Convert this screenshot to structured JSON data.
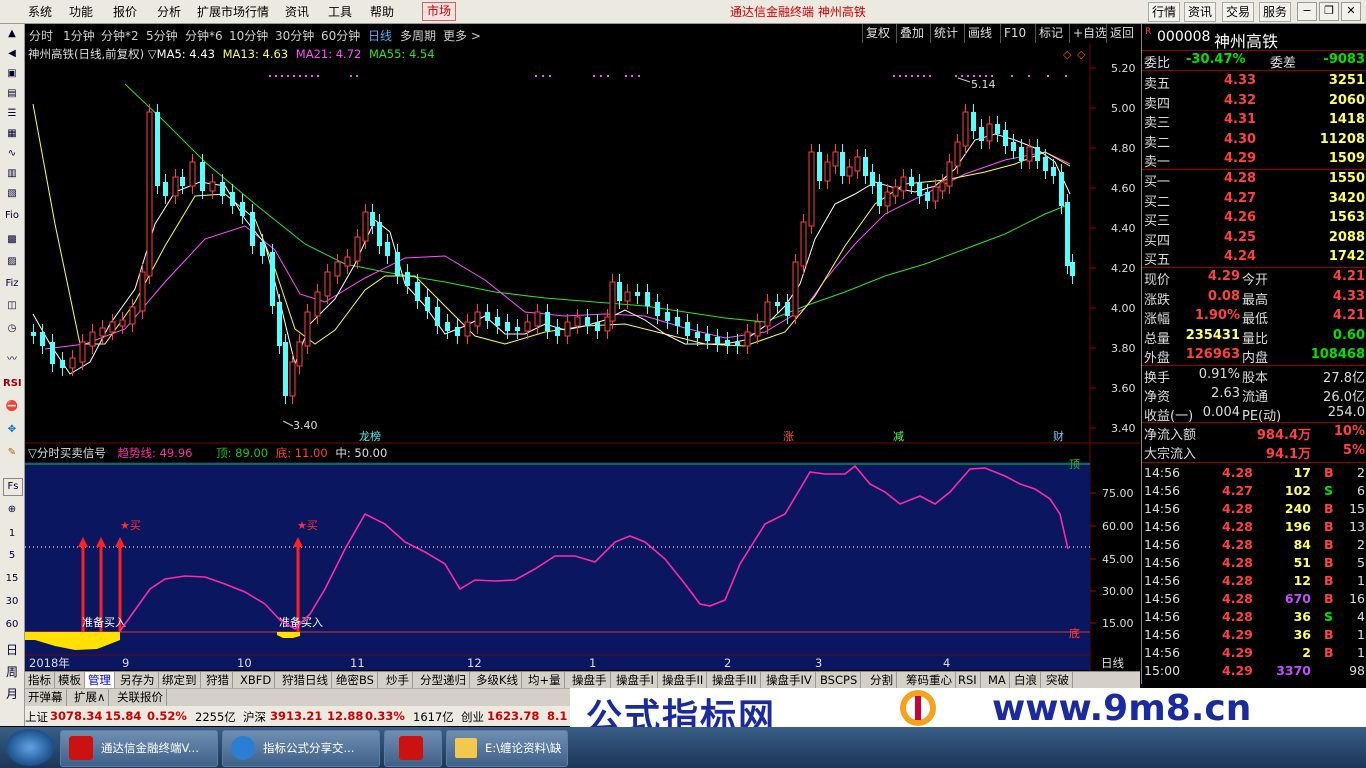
{
  "app": {
    "window_title": "通达信金融终端 神州高铁"
  },
  "menu": {
    "items": [
      "系统",
      "功能",
      "报价",
      "分析",
      "扩展市场行情",
      "资讯",
      "工具",
      "帮助"
    ],
    "market_label": "市场",
    "right_buttons": [
      "行情",
      "资讯",
      "交易",
      "服务"
    ]
  },
  "left_toolbar": {
    "period_labels": [
      "1",
      "5",
      "15",
      "30",
      "60",
      "日",
      "周",
      "月"
    ],
    "text_items": [
      "RSI",
      "Fs"
    ]
  },
  "chart_toolbar": {
    "periods": [
      "分时",
      "1分钟",
      "分钟*2",
      "5分钟",
      "分钟*6",
      "10分钟",
      "30分钟",
      "60分钟",
      "日线",
      "多周期",
      "更多 >"
    ],
    "active_period": "日线",
    "right_buttons": [
      "复权",
      "叠加",
      "统计",
      "画线",
      "F10",
      "标记",
      "+自选",
      "返回"
    ]
  },
  "kline_info": {
    "title": "神州高铁(日线,前复权)",
    "ma5": "MA5: 4.43",
    "ma13": "MA13: 4.63",
    "ma21": "MA21: 4.72",
    "ma55": "MA55: 4.54",
    "high_label": "5.14",
    "low_label": "3.40",
    "y_ticks": [
      "5.20",
      "5.00",
      "4.80",
      "4.60",
      "4.40",
      "4.20",
      "4.00",
      "3.80",
      "3.60",
      "3.40"
    ],
    "event_markers": [
      "龙榜",
      "涨",
      "减",
      "财"
    ]
  },
  "indicator": {
    "name": "分时买卖信号",
    "trend": "趋势线: 49.96",
    "top": "顶: 89.00",
    "bottom": "底: 11.00",
    "mid": "中: 50.00",
    "y_ticks": [
      "75.00",
      "60.00",
      "45.00",
      "30.00",
      "15.00"
    ],
    "top_label": "顶",
    "bottom_label": "底",
    "buy_label": "★买",
    "prepare_label": "准备买入"
  },
  "x_axis": {
    "labels": [
      "2018年",
      "9",
      "10",
      "11",
      "12",
      "1",
      "2",
      "3",
      "4"
    ],
    "period_label": "日线"
  },
  "bottom_tabs": {
    "row1": [
      "指标",
      "模板",
      "管理",
      "另存为",
      "绑定到",
      "狩猎",
      "XBFD",
      "狩猎日线",
      "绝密BS",
      "炒手",
      "分型递归",
      "多级K线",
      "均+量",
      "操盘手",
      "操盘手I",
      "操盘手II",
      "操盘手III",
      "操盘手IV",
      "BSCPS",
      "分割",
      "筹码重心",
      "RSI",
      "MA",
      "白浪",
      "突破"
    ],
    "row2": [
      "开弹幕",
      "扩展∧",
      "关联报价"
    ],
    "active": "管理"
  },
  "index_bar": {
    "sh_label": "上证",
    "sh_value": "3078.34",
    "sh_change": "15.84",
    "sh_pct": "0.52%",
    "sh_amount": "2255亿",
    "sz_label": "沪深",
    "sz_value": "3913.21",
    "sz_change": "12.88",
    "sz_pct": "0.33%",
    "sz_amount": "1617亿",
    "cy_label": "创业",
    "cy_value": "1623.78",
    "cy_change": "8.1"
  },
  "quote": {
    "code": "000008",
    "name": "神州高铁",
    "r_badge": "R",
    "weibi_label": "委比",
    "weibi": "-30.47%",
    "weicha_label": "委差",
    "weicha": "-9083",
    "asks": [
      {
        "label": "卖五",
        "price": "4.33",
        "vol": "3251"
      },
      {
        "label": "卖四",
        "price": "4.32",
        "vol": "2060"
      },
      {
        "label": "卖三",
        "price": "4.31",
        "vol": "1418"
      },
      {
        "label": "卖二",
        "price": "4.30",
        "vol": "11208"
      },
      {
        "label": "卖一",
        "price": "4.29",
        "vol": "1509"
      }
    ],
    "bids": [
      {
        "label": "买一",
        "price": "4.28",
        "vol": "1550"
      },
      {
        "label": "买二",
        "price": "4.27",
        "vol": "3420"
      },
      {
        "label": "买三",
        "price": "4.26",
        "vol": "1563"
      },
      {
        "label": "买四",
        "price": "4.25",
        "vol": "2088"
      },
      {
        "label": "买五",
        "price": "4.24",
        "vol": "1742"
      }
    ],
    "stats": [
      {
        "l1": "现价",
        "v1": "4.29",
        "l2": "今开",
        "v2": "4.21"
      },
      {
        "l1": "涨跌",
        "v1": "0.08",
        "l2": "最高",
        "v2": "4.33"
      },
      {
        "l1": "涨幅",
        "v1": "1.90%",
        "l2": "最低",
        "v2": "4.21"
      },
      {
        "l1": "总量",
        "v1": "235431",
        "l2": "量比",
        "v2": "0.60"
      },
      {
        "l1": "外盘",
        "v1": "126963",
        "l2": "内盘",
        "v2": "108468"
      }
    ],
    "extra": [
      {
        "l1": "换手",
        "v1": "0.91%",
        "l2": "股本",
        "v2": "27.8亿"
      },
      {
        "l1": "净资",
        "v1": "2.63",
        "l2": "流通",
        "v2": "26.0亿"
      },
      {
        "l1": "收益(一)",
        "v1": "0.004",
        "l2": "PE(动)",
        "v2": "254.0"
      }
    ],
    "flow": [
      {
        "label": "净流入额",
        "value": "984.4万",
        "pct": "10%"
      },
      {
        "label": "大宗流入",
        "value": "94.1万",
        "pct": "5%"
      }
    ],
    "ticks": [
      {
        "t": "14:56",
        "p": "4.28",
        "v": "17",
        "s": "B",
        "n": "2"
      },
      {
        "t": "14:56",
        "p": "4.27",
        "v": "102",
        "s": "S",
        "n": "6"
      },
      {
        "t": "14:56",
        "p": "4.28",
        "v": "240",
        "s": "B",
        "n": "15"
      },
      {
        "t": "14:56",
        "p": "4.28",
        "v": "196",
        "s": "B",
        "n": "13"
      },
      {
        "t": "14:56",
        "p": "4.28",
        "v": "84",
        "s": "B",
        "n": "2"
      },
      {
        "t": "14:56",
        "p": "4.28",
        "v": "51",
        "s": "B",
        "n": "5"
      },
      {
        "t": "14:56",
        "p": "4.28",
        "v": "12",
        "s": "B",
        "n": "1"
      },
      {
        "t": "14:56",
        "p": "4.28",
        "v": "670",
        "s": "B",
        "n": "16"
      },
      {
        "t": "14:56",
        "p": "4.28",
        "v": "36",
        "s": "S",
        "n": "4"
      },
      {
        "t": "14:56",
        "p": "4.29",
        "v": "36",
        "s": "B",
        "n": "1"
      },
      {
        "t": "14:56",
        "p": "4.29",
        "v": "2",
        "s": "B",
        "n": "1"
      },
      {
        "t": "15:00",
        "p": "4.29",
        "v": "3370",
        "s": "",
        "n": "98"
      }
    ]
  },
  "watermark": {
    "text": "公式指标网",
    "url": "www.9m8.cn"
  },
  "taskbar": {
    "items": [
      "通达信金融终端V...",
      "指标公式分享交...",
      "",
      "E:\\缠论资料\\缺"
    ]
  },
  "colors": {
    "up": "#ff4040",
    "down": "#54ffff",
    "ma5": "#ffffff",
    "ma13": "#ffff50",
    "ma21": "#ff50ff",
    "ma55": "#30e030",
    "trend": "#ff2aa6",
    "panel_bg": "#0a1660"
  }
}
